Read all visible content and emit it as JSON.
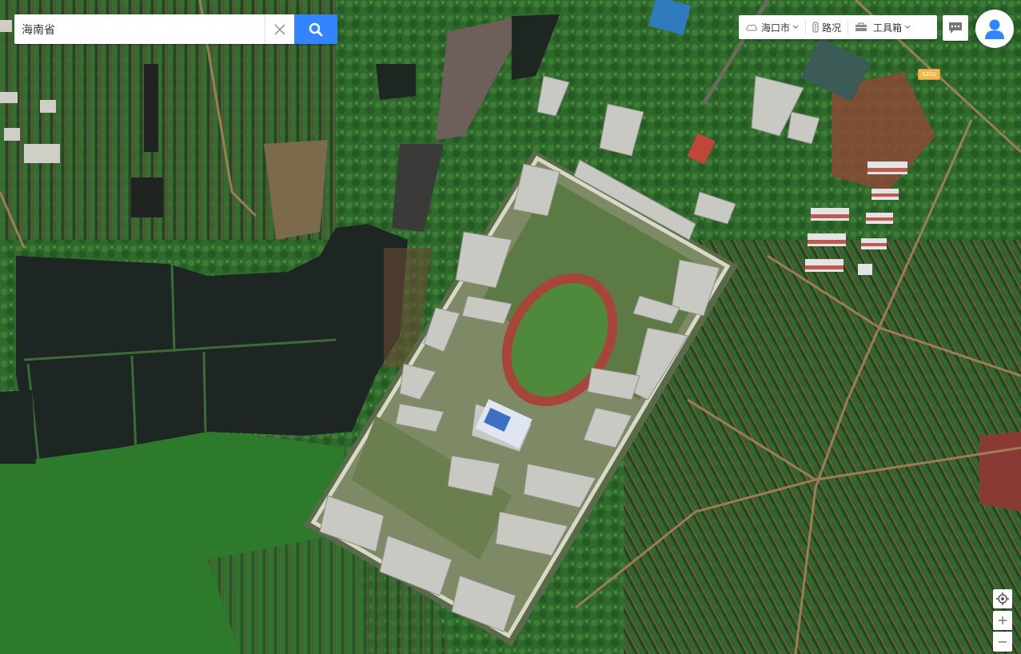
{
  "search": {
    "value": "海南省",
    "placeholder": ""
  },
  "toolbar": {
    "city": "海口市",
    "traffic": "路况",
    "tools": "工具箱"
  },
  "map": {
    "type": "satellite",
    "road_label": "S201"
  },
  "colors": {
    "accent": "#3385ff"
  },
  "icons": {
    "clear": "close-icon",
    "search": "search-icon",
    "city": "cloud-icon",
    "traffic": "traffic-light-icon",
    "tools": "toolbox-icon",
    "message": "message-icon",
    "avatar": "user-icon",
    "locate": "locate-icon"
  }
}
